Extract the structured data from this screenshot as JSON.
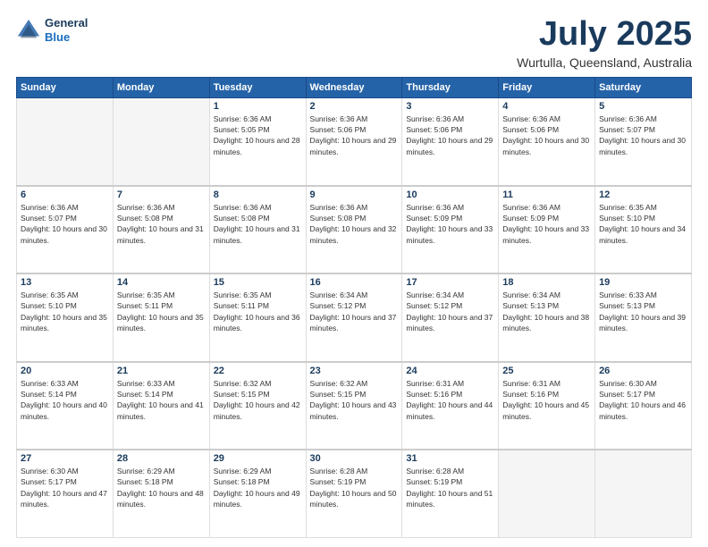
{
  "header": {
    "logo_line1": "General",
    "logo_line2": "Blue",
    "month": "July 2025",
    "location": "Wurtulla, Queensland, Australia"
  },
  "days_of_week": [
    "Sunday",
    "Monday",
    "Tuesday",
    "Wednesday",
    "Thursday",
    "Friday",
    "Saturday"
  ],
  "weeks": [
    [
      {
        "day": "",
        "empty": true
      },
      {
        "day": "",
        "empty": true
      },
      {
        "day": "1",
        "sunrise": "6:36 AM",
        "sunset": "5:05 PM",
        "daylight": "Daylight: 10 hours and 28 minutes."
      },
      {
        "day": "2",
        "sunrise": "6:36 AM",
        "sunset": "5:06 PM",
        "daylight": "Daylight: 10 hours and 29 minutes."
      },
      {
        "day": "3",
        "sunrise": "6:36 AM",
        "sunset": "5:06 PM",
        "daylight": "Daylight: 10 hours and 29 minutes."
      },
      {
        "day": "4",
        "sunrise": "6:36 AM",
        "sunset": "5:06 PM",
        "daylight": "Daylight: 10 hours and 30 minutes."
      },
      {
        "day": "5",
        "sunrise": "6:36 AM",
        "sunset": "5:07 PM",
        "daylight": "Daylight: 10 hours and 30 minutes."
      }
    ],
    [
      {
        "day": "6",
        "sunrise": "6:36 AM",
        "sunset": "5:07 PM",
        "daylight": "Daylight: 10 hours and 30 minutes."
      },
      {
        "day": "7",
        "sunrise": "6:36 AM",
        "sunset": "5:08 PM",
        "daylight": "Daylight: 10 hours and 31 minutes."
      },
      {
        "day": "8",
        "sunrise": "6:36 AM",
        "sunset": "5:08 PM",
        "daylight": "Daylight: 10 hours and 31 minutes."
      },
      {
        "day": "9",
        "sunrise": "6:36 AM",
        "sunset": "5:08 PM",
        "daylight": "Daylight: 10 hours and 32 minutes."
      },
      {
        "day": "10",
        "sunrise": "6:36 AM",
        "sunset": "5:09 PM",
        "daylight": "Daylight: 10 hours and 33 minutes."
      },
      {
        "day": "11",
        "sunrise": "6:36 AM",
        "sunset": "5:09 PM",
        "daylight": "Daylight: 10 hours and 33 minutes."
      },
      {
        "day": "12",
        "sunrise": "6:35 AM",
        "sunset": "5:10 PM",
        "daylight": "Daylight: 10 hours and 34 minutes."
      }
    ],
    [
      {
        "day": "13",
        "sunrise": "6:35 AM",
        "sunset": "5:10 PM",
        "daylight": "Daylight: 10 hours and 35 minutes."
      },
      {
        "day": "14",
        "sunrise": "6:35 AM",
        "sunset": "5:11 PM",
        "daylight": "Daylight: 10 hours and 35 minutes."
      },
      {
        "day": "15",
        "sunrise": "6:35 AM",
        "sunset": "5:11 PM",
        "daylight": "Daylight: 10 hours and 36 minutes."
      },
      {
        "day": "16",
        "sunrise": "6:34 AM",
        "sunset": "5:12 PM",
        "daylight": "Daylight: 10 hours and 37 minutes."
      },
      {
        "day": "17",
        "sunrise": "6:34 AM",
        "sunset": "5:12 PM",
        "daylight": "Daylight: 10 hours and 37 minutes."
      },
      {
        "day": "18",
        "sunrise": "6:34 AM",
        "sunset": "5:13 PM",
        "daylight": "Daylight: 10 hours and 38 minutes."
      },
      {
        "day": "19",
        "sunrise": "6:33 AM",
        "sunset": "5:13 PM",
        "daylight": "Daylight: 10 hours and 39 minutes."
      }
    ],
    [
      {
        "day": "20",
        "sunrise": "6:33 AM",
        "sunset": "5:14 PM",
        "daylight": "Daylight: 10 hours and 40 minutes."
      },
      {
        "day": "21",
        "sunrise": "6:33 AM",
        "sunset": "5:14 PM",
        "daylight": "Daylight: 10 hours and 41 minutes."
      },
      {
        "day": "22",
        "sunrise": "6:32 AM",
        "sunset": "5:15 PM",
        "daylight": "Daylight: 10 hours and 42 minutes."
      },
      {
        "day": "23",
        "sunrise": "6:32 AM",
        "sunset": "5:15 PM",
        "daylight": "Daylight: 10 hours and 43 minutes."
      },
      {
        "day": "24",
        "sunrise": "6:31 AM",
        "sunset": "5:16 PM",
        "daylight": "Daylight: 10 hours and 44 minutes."
      },
      {
        "day": "25",
        "sunrise": "6:31 AM",
        "sunset": "5:16 PM",
        "daylight": "Daylight: 10 hours and 45 minutes."
      },
      {
        "day": "26",
        "sunrise": "6:30 AM",
        "sunset": "5:17 PM",
        "daylight": "Daylight: 10 hours and 46 minutes."
      }
    ],
    [
      {
        "day": "27",
        "sunrise": "6:30 AM",
        "sunset": "5:17 PM",
        "daylight": "Daylight: 10 hours and 47 minutes."
      },
      {
        "day": "28",
        "sunrise": "6:29 AM",
        "sunset": "5:18 PM",
        "daylight": "Daylight: 10 hours and 48 minutes."
      },
      {
        "day": "29",
        "sunrise": "6:29 AM",
        "sunset": "5:18 PM",
        "daylight": "Daylight: 10 hours and 49 minutes."
      },
      {
        "day": "30",
        "sunrise": "6:28 AM",
        "sunset": "5:19 PM",
        "daylight": "Daylight: 10 hours and 50 minutes."
      },
      {
        "day": "31",
        "sunrise": "6:28 AM",
        "sunset": "5:19 PM",
        "daylight": "Daylight: 10 hours and 51 minutes."
      },
      {
        "day": "",
        "empty": true
      },
      {
        "day": "",
        "empty": true
      }
    ]
  ]
}
